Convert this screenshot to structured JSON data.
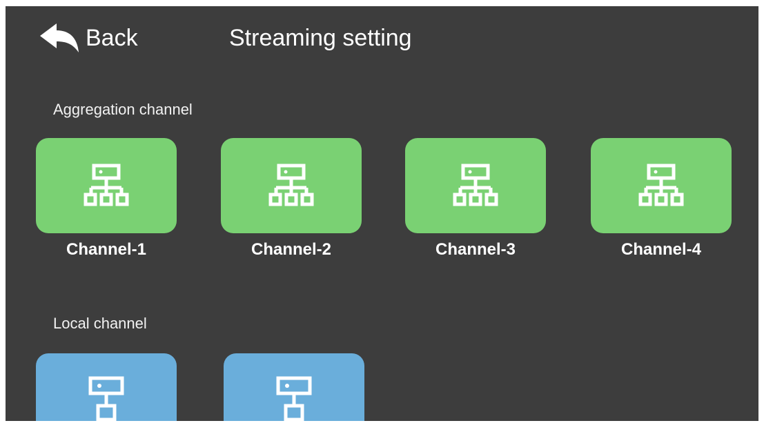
{
  "header": {
    "back_label": "Back",
    "title": "Streaming setting",
    "back_icon": "back-arrow-icon"
  },
  "aggregation": {
    "label": "Aggregation channel",
    "color": "#7ad173",
    "icon": "network-icon",
    "channels": [
      {
        "label": "Channel-1"
      },
      {
        "label": "Channel-2"
      },
      {
        "label": "Channel-3"
      },
      {
        "label": "Channel-4"
      }
    ]
  },
  "local": {
    "label": "Local channel",
    "color": "#6aaedb",
    "icon": "device-icon"
  },
  "colors": {
    "background": "#3d3d3d",
    "text": "#ffffff"
  }
}
